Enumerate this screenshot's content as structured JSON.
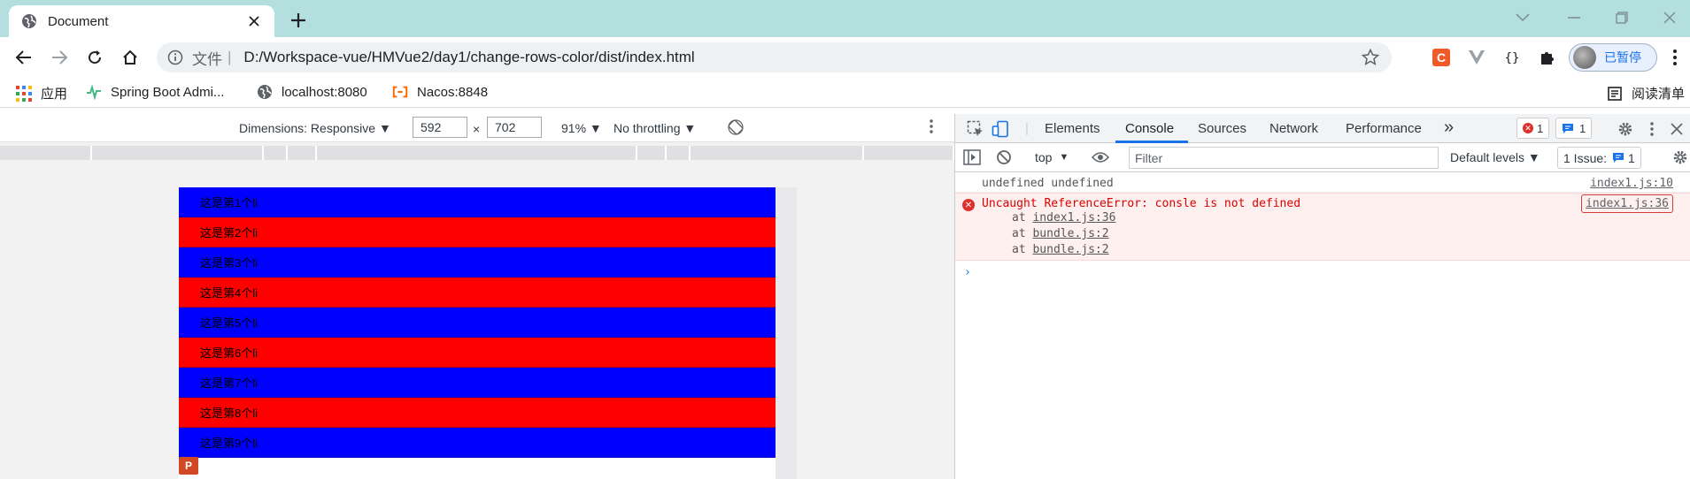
{
  "browser": {
    "tab_title": "Document",
    "url_scheme": "文件",
    "url_separator": "|",
    "url": "D:/Workspace-vue/HMVue2/day1/change-rows-color/dist/index.html",
    "profile_label": "已暂停"
  },
  "bookmarks": {
    "items": [
      {
        "label": "应用",
        "icon": "apps-grid-icon"
      },
      {
        "label": "Spring Boot Admi...",
        "icon": "spring-boot-icon"
      },
      {
        "label": "localhost:8080",
        "icon": "globe-icon"
      },
      {
        "label": "Nacos:8848",
        "icon": "nacos-icon"
      }
    ],
    "reading_list": "阅读清单"
  },
  "device_toolbar": {
    "dimensions_label": "Dimensions: Responsive ▼",
    "width": "592",
    "times": "×",
    "height": "702",
    "zoom": "91% ▼",
    "throttling": "No throttling ▼"
  },
  "page": {
    "rows": [
      "这是第1个li",
      "这是第2个li",
      "这是第3个li",
      "这是第4个li",
      "这是第5个li",
      "这是第6个li",
      "这是第7个li",
      "这是第8个li",
      "这是第9个li"
    ],
    "row_colors": [
      "#0000ff",
      "#ff0000"
    ],
    "ppt_icon_letter": "P"
  },
  "devtools": {
    "tabs": [
      "Elements",
      "Console",
      "Sources",
      "Network",
      "Performance"
    ],
    "active_tab": "Console",
    "more_tabs": "»",
    "error_count": "1",
    "message_count": "1",
    "context": "top",
    "filter_placeholder": "Filter",
    "levels": "Default levels ▼",
    "issues_label": "1 Issue:",
    "issues_count": "1",
    "console": {
      "log_text": "undefined undefined",
      "log_source": "index1.js:10",
      "error_text": "Uncaught ReferenceError: consle is not defined",
      "error_source": "index1.js:36",
      "stack": [
        {
          "prefix": "at",
          "location": "index1.js:36"
        },
        {
          "prefix": "at",
          "location": "bundle.js:2"
        },
        {
          "prefix": "at",
          "location": "bundle.js:2"
        }
      ],
      "prompt": "›"
    }
  }
}
